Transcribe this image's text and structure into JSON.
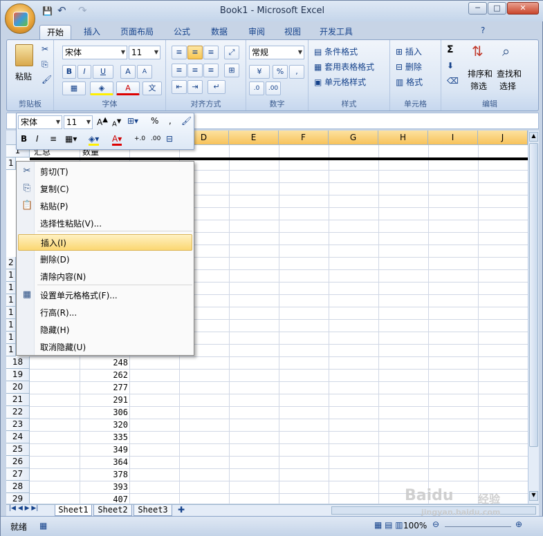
{
  "window": {
    "title": "Book1 - Microsoft Excel",
    "minimize": "─",
    "maximize": "□",
    "close": "✕"
  },
  "qat": {
    "save": "💾",
    "undo": "↶",
    "redo": "↷"
  },
  "tabs": [
    "开始",
    "插入",
    "页面布局",
    "公式",
    "数据",
    "审阅",
    "视图",
    "开发工具"
  ],
  "ribbon": {
    "clipboard": {
      "label": "剪贴板",
      "paste": "粘贴"
    },
    "font": {
      "label": "字体",
      "name": "宋体",
      "size": "11",
      "bold": "B",
      "italic": "I",
      "underline": "U",
      "grow": "A",
      "shrink": "A",
      "wen": "文"
    },
    "align": {
      "label": "对齐方式"
    },
    "number": {
      "label": "数字",
      "format": "常规",
      "percent": "%",
      "comma": ","
    },
    "styles": {
      "label": "样式",
      "cond": "条件格式",
      "table": "套用表格格式",
      "cell": "单元格样式"
    },
    "cells": {
      "label": "单元格",
      "insert": "插入",
      "delete": "删除",
      "format": "格式"
    },
    "edit": {
      "label": "编辑",
      "sum": "Σ",
      "sort": "排序和",
      "sort2": "筛选",
      "find": "查找和",
      "find2": "选择"
    }
  },
  "minitoolbar": {
    "font": "宋体",
    "size": "11",
    "bold": "B",
    "italic": "I",
    "percent": "%",
    "comma": ","
  },
  "grid": {
    "columns": [
      "D",
      "E",
      "F",
      "G",
      "H",
      "I",
      "J"
    ],
    "visible_row_start": "1",
    "header_cells": {
      "a1": "汇总",
      "b1": "数量"
    },
    "rows": [
      {
        "n": "18",
        "v": "248"
      },
      {
        "n": "19",
        "v": "262"
      },
      {
        "n": "20",
        "v": "277"
      },
      {
        "n": "21",
        "v": "291"
      },
      {
        "n": "22",
        "v": "306"
      },
      {
        "n": "23",
        "v": "320"
      },
      {
        "n": "24",
        "v": "335"
      },
      {
        "n": "25",
        "v": "349"
      },
      {
        "n": "26",
        "v": "364"
      },
      {
        "n": "27",
        "v": "378"
      },
      {
        "n": "28",
        "v": "393"
      },
      {
        "n": "29",
        "v": "407"
      }
    ],
    "partial_rows": [
      "1",
      "2",
      "1",
      "1",
      "1",
      "1",
      "1",
      "1",
      "1",
      "1",
      "1",
      "1"
    ]
  },
  "context_menu": [
    {
      "label": "剪切(T)",
      "icon": "✂"
    },
    {
      "label": "复制(C)",
      "icon": "⎘"
    },
    {
      "label": "粘贴(P)",
      "icon": "📋"
    },
    {
      "label": "选择性粘贴(V)...",
      "icon": ""
    },
    {
      "label": "插入(I)",
      "icon": ""
    },
    {
      "label": "删除(D)",
      "icon": ""
    },
    {
      "label": "清除内容(N)",
      "icon": ""
    },
    {
      "label": "设置单元格格式(F)...",
      "icon": "▦"
    },
    {
      "label": "行高(R)...",
      "icon": ""
    },
    {
      "label": "隐藏(H)",
      "icon": ""
    },
    {
      "label": "取消隐藏(U)",
      "icon": ""
    }
  ],
  "sheets": [
    "Sheet1",
    "Sheet2",
    "Sheet3"
  ],
  "status": {
    "ready": "就绪",
    "zoom": "100%"
  },
  "watermark": {
    "brand": "Baidu",
    "jy": "经验",
    "url": "jingyan.baidu.com"
  },
  "colors": {
    "accent": "#15428b",
    "highlight": "#f8c650"
  }
}
